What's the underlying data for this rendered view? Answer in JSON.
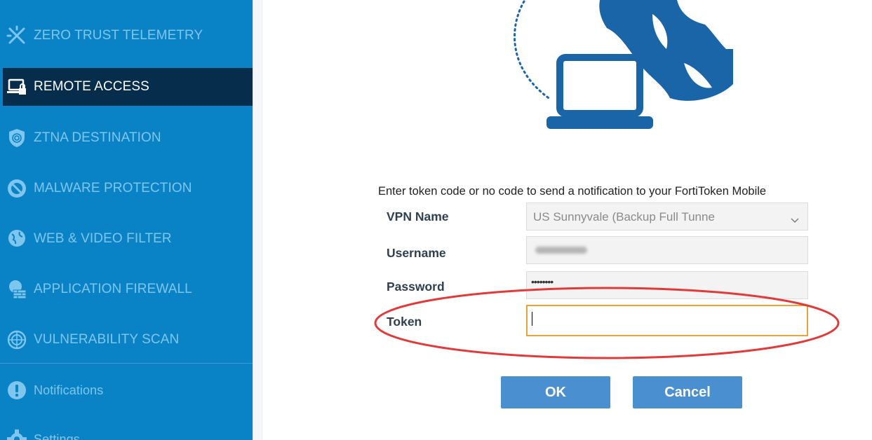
{
  "sidebar": {
    "items": [
      {
        "label": "ZERO TRUST TELEMETRY",
        "icon": "telemetry-icon"
      },
      {
        "label": "REMOTE ACCESS",
        "icon": "laptop-lock-icon",
        "active": true
      },
      {
        "label": "ZTNA DESTINATION",
        "icon": "shield-fingerprint-icon"
      },
      {
        "label": "MALWARE PROTECTION",
        "icon": "malware-blocked-icon"
      },
      {
        "label": "WEB & VIDEO FILTER",
        "icon": "globe-filter-icon"
      },
      {
        "label": "APPLICATION FIREWALL",
        "icon": "app-firewall-icon"
      },
      {
        "label": "VULNERABILITY SCAN",
        "icon": "radar-icon"
      }
    ],
    "notifications_label": "Notifications",
    "settings_label": "Settings"
  },
  "main": {
    "illustration": "laptop-globe-icon",
    "instructions": "Enter token code or no code to send a notification to your FortiToken Mobile",
    "form": {
      "vpn_name_label": "VPN Name",
      "vpn_name_value": "US Sunnyvale (Backup Full Tunne",
      "username_label": "Username",
      "password_label": "Password",
      "password_mask": "••••••••",
      "token_label": "Token",
      "token_value": ""
    },
    "ok_label": "OK",
    "cancel_label": "Cancel"
  },
  "colors": {
    "sidebar_bg": "#0a82c6",
    "active_bg": "#062d4c",
    "button_bg": "#4a8fd0",
    "token_border": "#e8a33a",
    "annotation_red": "#e03a3a"
  }
}
